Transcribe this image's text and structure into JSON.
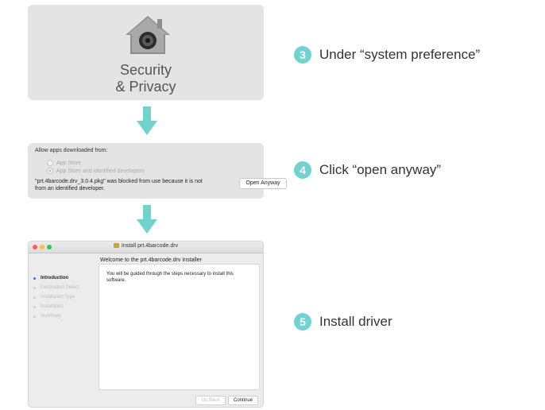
{
  "colors": {
    "accent": "#6fd3ce",
    "panel": "#e4e4e4"
  },
  "panel1": {
    "icon": "security-privacy-house-icon",
    "title_line1": "Security",
    "title_line2": "& Privacy"
  },
  "panel2": {
    "allow_label": "Allow apps downloaded from:",
    "options": [
      "App Store",
      "App Store and identified developers"
    ],
    "selected_option": "App Store and identified developers",
    "blocked_message": "\"prt.4barcode.drv_3.0.4.pkg\" was blocked from use because it is not from an identified developer.",
    "open_anyway_label": "Open Anyway"
  },
  "installer": {
    "window_title": "Install prt.4barcode.drv",
    "welcome_heading": "Welcome to the prt.4barcode.drv Installer",
    "steps": [
      "Introduction",
      "Destination Select",
      "Installation Type",
      "Installation",
      "Summary"
    ],
    "active_step": "Introduction",
    "body_text": "You will be guided through the steps necessary to install this software.",
    "go_back_label": "Go Back",
    "continue_label": "Continue"
  },
  "instructions": [
    {
      "number": "3",
      "text": "Under “system preference”"
    },
    {
      "number": "4",
      "text": "Click “open anyway”"
    },
    {
      "number": "5",
      "text": "Install driver"
    }
  ]
}
